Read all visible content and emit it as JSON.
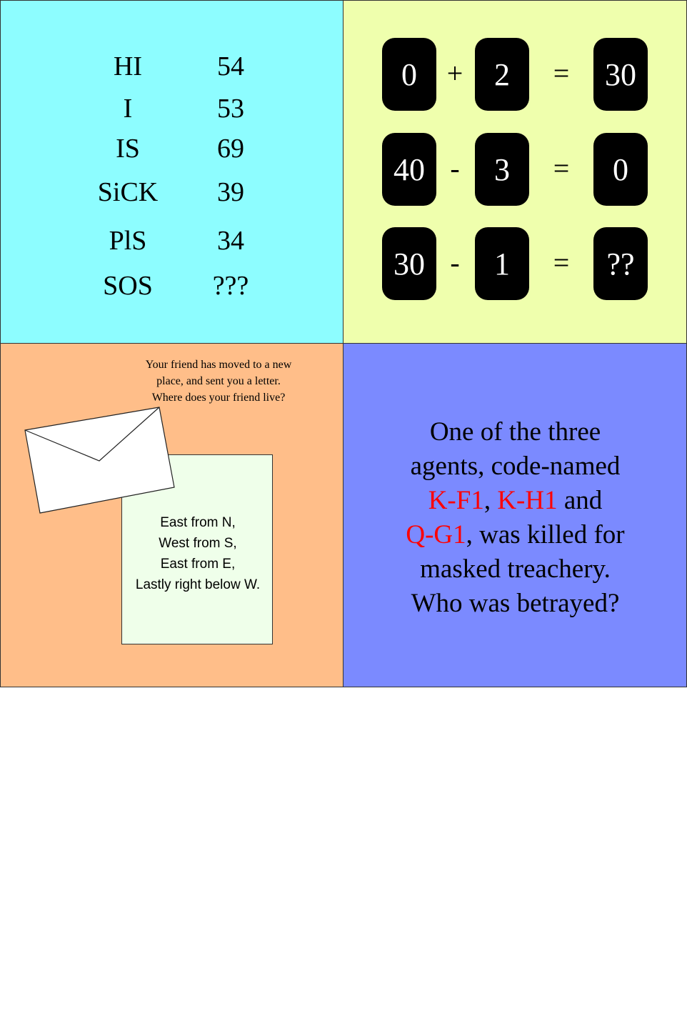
{
  "puzzle_codewords": {
    "rows": [
      {
        "word": "HI",
        "value": "54"
      },
      {
        "word": "I",
        "value": "53"
      },
      {
        "word": "IS",
        "value": "69"
      },
      {
        "word": "SiCK",
        "value": "39"
      },
      {
        "word": "PlS",
        "value": "34"
      },
      {
        "word": "SOS",
        "value": "???"
      }
    ]
  },
  "puzzle_equations": {
    "rows": [
      {
        "a": "0",
        "op": "+",
        "b": "2",
        "eq": "=",
        "result": "30"
      },
      {
        "a": "40",
        "op": "-",
        "b": "3",
        "eq": "=",
        "result": "0"
      },
      {
        "a": "30",
        "op": "-",
        "b": "1",
        "eq": "=",
        "result": "??"
      }
    ]
  },
  "puzzle_letter": {
    "prompt_lines": [
      "Your friend has moved to a new",
      "place, and sent you a letter.",
      "Where does your friend live?"
    ],
    "letter_lines": [
      "East from N,",
      "West from S,",
      "East from E,",
      "Lastly right below W."
    ]
  },
  "puzzle_agents": {
    "line1": "One of the three",
    "line2": "agents, code-named",
    "agent1": "K-F1",
    "sep1": ", ",
    "agent2": "K-H1",
    "and_text": " and",
    "agent3": "Q-G1",
    "line4_rest": ", was killed for",
    "line5": "masked treachery.",
    "line6": "Who was betrayed?"
  },
  "colors": {
    "panel_codewords": "#8dfdff",
    "panel_equations": "#efffad",
    "panel_letter": "#ffbe89",
    "panel_agents": "#7b8aff",
    "letter_paper": "#efffea",
    "agent_highlight": "#ff0000",
    "tile": "#000000"
  }
}
